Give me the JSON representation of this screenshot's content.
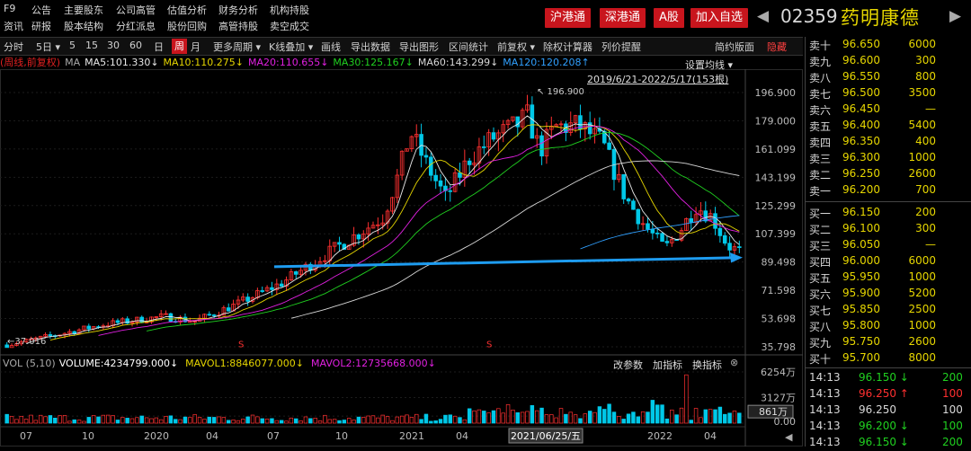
{
  "top_menu": {
    "row1": [
      "F9",
      "公告",
      "主要股东",
      "公司高管",
      "估值分析",
      "财务分析",
      "机构持股"
    ],
    "row2": [
      "资讯",
      "研报",
      "股本结构",
      "分红派息",
      "股份回购",
      "高管持股",
      "卖空成交"
    ]
  },
  "tags": [
    "沪港通",
    "深港通",
    "A股",
    "加入自选"
  ],
  "stock": {
    "code": "02359",
    "name": "药明康德"
  },
  "toolbar": {
    "items": [
      "分时",
      "5日",
      "5",
      "15",
      "30",
      "60",
      "日",
      "周",
      "月",
      "更多周期",
      "K线叠加",
      "画线",
      "导出数据",
      "导出图形",
      "区间统计",
      "前复权",
      "除权计算器",
      "列价提醒",
      "简约版面",
      "隐藏"
    ],
    "active": "周",
    "dropdowns": [
      "5日",
      "更多周期",
      "K线叠加",
      "前复权"
    ]
  },
  "ma_legend": {
    "prefix": "(周线,前复权)",
    "ma_label": "MA",
    "items": [
      {
        "text": "MA5:101.330↓",
        "color": "#e8e8e8"
      },
      {
        "text": "MA10:110.275↓",
        "color": "#e6d600"
      },
      {
        "text": "MA20:110.655↓",
        "color": "#e020e0"
      },
      {
        "text": "MA30:125.167↓",
        "color": "#20d020"
      },
      {
        "text": "MA60:143.299↓",
        "color": "#d8d8d8"
      },
      {
        "text": "MA120:120.208↑",
        "color": "#30a0ff"
      }
    ]
  },
  "settings_label": "设置均线",
  "range_label": "2019/6/21-2022/5/17(153根)",
  "price_axis": [
    "196.900",
    "179.000",
    "161.099",
    "143.199",
    "125.299",
    "107.399",
    "89.498",
    "71.598",
    "53.698",
    "35.798"
  ],
  "high_marker": "196.900",
  "low_marker": "37.016",
  "volume_legend": {
    "vol": "VOL (5,10)",
    "volume": "VOLUME:4234799.000↓",
    "mavol1": "MAVOL1:8846077.000↓",
    "mavol2": "MAVOL2:12735668.000↓",
    "buttons": [
      "改参数",
      "加指标",
      "换指标"
    ]
  },
  "volume_axis": [
    "6254万",
    "3127万",
    "861万",
    "0.00"
  ],
  "x_axis": [
    "07",
    "10",
    "2020",
    "04",
    "07",
    "10",
    "2021",
    "04",
    "2021/06/25/五",
    "2022",
    "04"
  ],
  "chart_data": {
    "type": "candlestick",
    "title": "",
    "period": "weekly",
    "ylim": [
      35.798,
      196.9
    ],
    "y_ticks": [
      196.9,
      179.0,
      161.099,
      143.199,
      125.299,
      107.399,
      89.498,
      71.598,
      53.698,
      35.798
    ],
    "high": 196.9,
    "low": 37.016,
    "ma_values": {
      "MA5": 101.33,
      "MA10": 110.275,
      "MA20": 110.655,
      "MA30": 125.167,
      "MA60": 143.299,
      "MA120": 120.208
    },
    "volume_ylim_wan": [
      0,
      6254
    ],
    "grid": true
  },
  "orderbook": {
    "sell": [
      {
        "label": "卖十",
        "price": "96.650",
        "qty": "6000"
      },
      {
        "label": "卖九",
        "price": "96.600",
        "qty": "300"
      },
      {
        "label": "卖八",
        "price": "96.550",
        "qty": "800"
      },
      {
        "label": "卖七",
        "price": "96.500",
        "qty": "3500"
      },
      {
        "label": "卖六",
        "price": "96.450",
        "qty": "—"
      },
      {
        "label": "卖五",
        "price": "96.400",
        "qty": "5400"
      },
      {
        "label": "卖四",
        "price": "96.350",
        "qty": "400"
      },
      {
        "label": "卖三",
        "price": "96.300",
        "qty": "1000"
      },
      {
        "label": "卖二",
        "price": "96.250",
        "qty": "2600"
      },
      {
        "label": "卖一",
        "price": "96.200",
        "qty": "700"
      }
    ],
    "buy": [
      {
        "label": "买一",
        "price": "96.150",
        "qty": "200"
      },
      {
        "label": "买二",
        "price": "96.100",
        "qty": "300"
      },
      {
        "label": "买三",
        "price": "96.050",
        "qty": "—"
      },
      {
        "label": "买四",
        "price": "96.000",
        "qty": "6000"
      },
      {
        "label": "买五",
        "price": "95.950",
        "qty": "1000"
      },
      {
        "label": "买六",
        "price": "95.900",
        "qty": "5200"
      },
      {
        "label": "买七",
        "price": "95.850",
        "qty": "2500"
      },
      {
        "label": "买八",
        "price": "95.800",
        "qty": "1000"
      },
      {
        "label": "买九",
        "price": "95.750",
        "qty": "2600"
      },
      {
        "label": "买十",
        "price": "95.700",
        "qty": "8000"
      }
    ],
    "trades": [
      {
        "time": "14:13",
        "price": "96.150",
        "dir": "↓",
        "qty": "200",
        "color": "#20d020"
      },
      {
        "time": "14:13",
        "price": "96.250",
        "dir": "↑",
        "qty": "100",
        "color": "#ff3030"
      },
      {
        "time": "14:13",
        "price": "96.250",
        "dir": "",
        "qty": "100",
        "color": "#d8d8d8"
      },
      {
        "time": "14:13",
        "price": "96.200",
        "dir": "↓",
        "qty": "100",
        "color": "#20d020"
      },
      {
        "time": "14:13",
        "price": "96.150",
        "dir": "↓",
        "qty": "200",
        "color": "#20d020"
      }
    ]
  }
}
